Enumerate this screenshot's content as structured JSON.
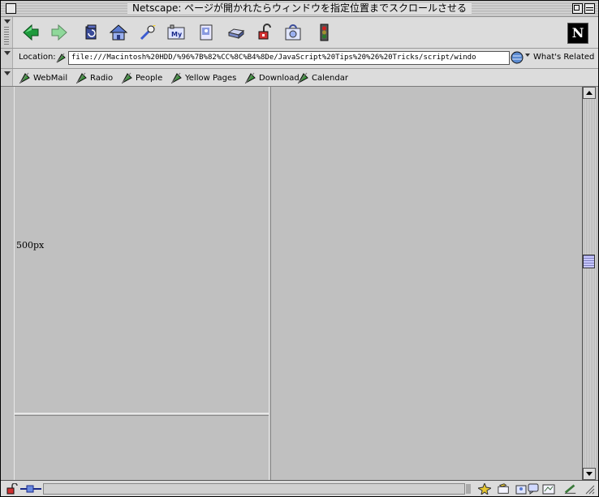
{
  "window": {
    "title": "Netscape: ページが開かれたらウィンドウを指定位置までスクロールさせる"
  },
  "toolbar": {
    "buttons": [
      {
        "name": "back",
        "icon": "back-arrow-icon"
      },
      {
        "name": "forward",
        "icon": "forward-arrow-icon"
      },
      {
        "name": "reload",
        "icon": "reload-icon"
      },
      {
        "name": "home",
        "icon": "home-icon"
      },
      {
        "name": "search",
        "icon": "search-icon"
      },
      {
        "name": "my-netscape",
        "icon": "my-netscape-icon",
        "label": "My"
      },
      {
        "name": "images",
        "icon": "images-icon"
      },
      {
        "name": "print",
        "icon": "print-icon"
      },
      {
        "name": "security",
        "icon": "lock-icon"
      },
      {
        "name": "shop",
        "icon": "shop-icon"
      },
      {
        "name": "stop",
        "icon": "stop-icon"
      }
    ],
    "logo": "N"
  },
  "location": {
    "label": "Location:",
    "url": "file:///Macintosh%20HDD/%96%7B%82%CC%8C%B4%8De/JavaScript%20Tips%20%26%20Tricks/script/windo",
    "whats_related": "What's Related"
  },
  "personal_toolbar": {
    "items": [
      "WebMail",
      "Radio",
      "People",
      "Yellow Pages",
      "Download",
      "Calendar"
    ]
  },
  "content": {
    "left_frame_text": "500px"
  },
  "colors": {
    "window_bg": "#dcdcdc",
    "content_bg": "#c0c0c0",
    "scroll_thumb": "#c8c8ff"
  }
}
